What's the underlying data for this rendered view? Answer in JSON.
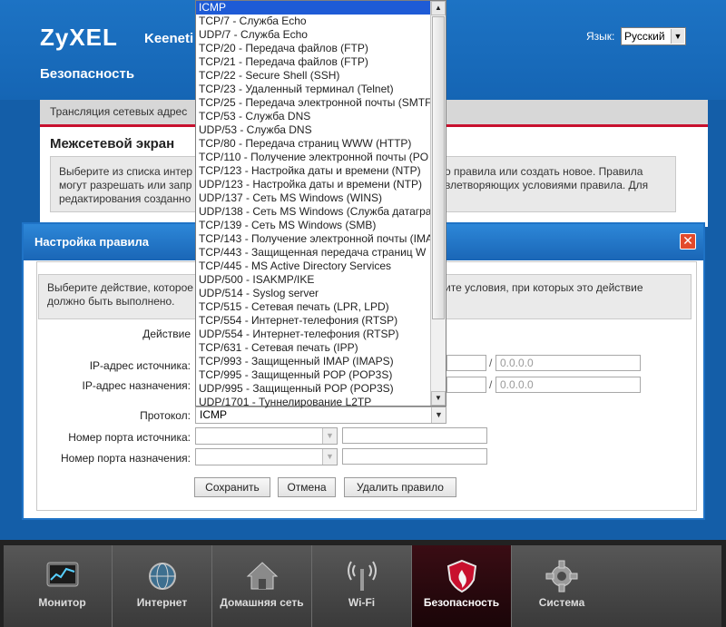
{
  "header": {
    "logo": "ZyXEL",
    "product": "Keeneti",
    "language_label": "Язык:",
    "language_value": "Русский",
    "page_title": "Безопасность"
  },
  "background": {
    "tab": "Трансляция сетевых адрес",
    "section": "Межсетевой экран",
    "note_left": [
      "Выберите из списка интер",
      "могут разрешать или запр",
      "редактирования созданно"
    ],
    "note_right": [
      "о правила или создать новое. Правила",
      "влетворяющих условиями правила. Для"
    ]
  },
  "modal": {
    "title": "Настройка правила",
    "close": "✕",
    "note_left": [
      "Выберите действие, которое",
      "должно быть выполнено."
    ],
    "note_right": [
      "ите условия, при которых это действие"
    ],
    "action_label": "Действие",
    "source_ip_label": "IP-адрес источника:",
    "dest_ip_label": "IP-адрес назначения:",
    "mask_placeholder": "0.0.0.0",
    "slash": "/",
    "protocol_label": "Протокол:",
    "protocol_value": "ICMP",
    "source_port_label": "Номер порта источника:",
    "dest_port_label": "Номер порта назначения:",
    "save_button": "Сохранить",
    "cancel_button": "Отмена",
    "delete_button": "Удалить правило"
  },
  "dropdown": {
    "selected_index": 0,
    "items": [
      "ICMP",
      "TCP/7 - Служба Echo",
      "UDP/7 - Служба Echo",
      "TCP/20 - Передача файлов (FTP)",
      "TCP/21 - Передача файлов (FTP)",
      "TCP/22 - Secure Shell (SSH)",
      "TCP/23 - Удаленный терминал (Telnet)",
      "TCP/25 - Передача электронной почты (SMTF",
      "TCP/53 - Служба DNS",
      "UDP/53 - Служба DNS",
      "TCP/80 - Передача страниц WWW (HTTP)",
      "TCP/110 - Получение электронной почты (PO",
      "TCP/123 - Настройка даты и времени (NTP)",
      "UDP/123 - Настройка даты и времени (NTP)",
      "UDP/137 - Сеть MS Windows (WINS)",
      "UDP/138 - Сеть MS Windows (Служба датагра",
      "TCP/139 - Сеть MS Windows (SMB)",
      "TCP/143 - Получение электронной почты (IMA",
      "TCP/443 - Защищенная передача страниц W",
      "TCP/445 - MS Active Directory Services",
      "UDP/500 - ISAKMP/IKE",
      "UDP/514 - Syslog server",
      "TCP/515 - Сетевая печать (LPR, LPD)",
      "TCP/554 - Интернет-телефония (RTSP)",
      "UDP/554 - Интернет-телефония (RTSP)",
      "TCP/631 - Сетевая печать (IPP)",
      "TCP/993 - Защищенный IMAP (IMAPS)",
      "TCP/995 - Защищенный POP (POP3S)",
      "UDP/995 - Защищенный POP (POP3S)",
      "UDP/1701 - Туннелирование L2TP"
    ]
  },
  "taskbar": {
    "items": [
      {
        "label": "Монитор",
        "icon": "monitor-icon"
      },
      {
        "label": "Интернет",
        "icon": "globe-icon"
      },
      {
        "label": "Домашняя сеть",
        "icon": "house-icon"
      },
      {
        "label": "Wi-Fi",
        "icon": "wifi-antenna-icon"
      },
      {
        "label": "Безопасность",
        "icon": "shield-icon"
      },
      {
        "label": "Система",
        "icon": "gear-icon"
      }
    ],
    "active_index": 4
  },
  "colors": {
    "page_bg": "#145ea8",
    "accent_red": "#c8102e",
    "selection_blue": "#1e5bd6"
  }
}
